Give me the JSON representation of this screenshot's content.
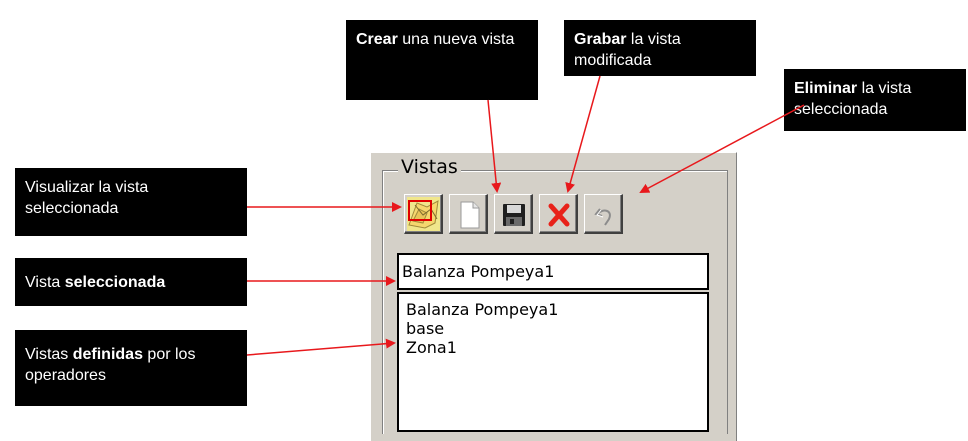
{
  "panel": {
    "title": "Vistas",
    "toolbar": [
      {
        "name": "visualize-view-button",
        "icon": "map-view-icon"
      },
      {
        "name": "new-view-button",
        "icon": "new-document-icon"
      },
      {
        "name": "save-view-button",
        "icon": "floppy-disk-icon"
      },
      {
        "name": "delete-view-button",
        "icon": "red-x-icon"
      },
      {
        "name": "undo-button",
        "icon": "undo-arrow-icon",
        "disabled": true
      }
    ],
    "selected_view": "Balanza Pompeya1",
    "views": [
      "Balanza Pompeya1",
      "base",
      "Zona1"
    ]
  },
  "callouts": {
    "create": {
      "bold": "Crear",
      "rest": " una nueva vista"
    },
    "save": {
      "bold": "Grabar",
      "rest": " la vista modificada"
    },
    "delete": {
      "bold": "Eliminar",
      "rest": " la vista seleccionada"
    },
    "visualize": {
      "bold": "",
      "rest": "Visualizar la vista seleccionada"
    },
    "selected": {
      "lead": "Vista ",
      "bold": "seleccionada"
    },
    "defined": {
      "lead": "Vistas ",
      "bold": "definidas",
      "rest": " por los operadores"
    }
  },
  "colors": {
    "arrow": "#e8181c",
    "callout_bg": "#000000",
    "panel_bg": "#d4d0c8"
  }
}
